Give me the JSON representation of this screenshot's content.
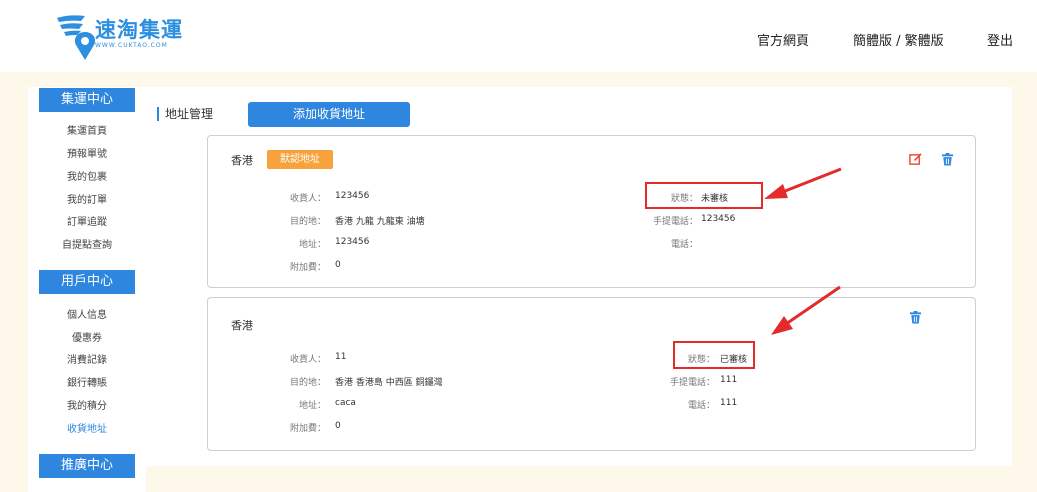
{
  "brand": {
    "name": "速淘集運",
    "site": "WWW.CUKTAO.COM"
  },
  "nav": {
    "official": "官方網頁",
    "lang": "簡體版 / 繁體版",
    "logout": "登出"
  },
  "sidebar": {
    "groups": [
      {
        "title": "集運中心",
        "items": [
          "集運首頁",
          "預報單號",
          "我的包裹",
          "我的訂單",
          "訂單追蹤",
          "自提點查詢"
        ]
      },
      {
        "title": "用戶中心",
        "items": [
          "個人信息",
          "優惠券",
          "消費記錄",
          "銀行轉賬",
          "我的積分",
          "收貨地址"
        ]
      },
      {
        "title": "推廣中心",
        "items": []
      }
    ],
    "active": "收貨地址"
  },
  "main": {
    "title": "地址管理",
    "add_label": "添加收貨地址",
    "labels": {
      "receiver": "收貨人：",
      "destination": "目的地：",
      "address": "地址：",
      "surcharge": "附加費：",
      "status": "狀態：",
      "mobile": "手提電話：",
      "phone": "電話："
    },
    "cards": [
      {
        "region": "香港",
        "default_tag": "默認地址",
        "receiver": "123456",
        "destination": "香港 九龍 九龍東 油塘",
        "address": "123456",
        "surcharge": "0",
        "status": "未審核",
        "mobile": "123456",
        "phone": ""
      },
      {
        "region": "香港",
        "receiver": "11",
        "destination": "香港 香港島 中西區 銅鑼灣",
        "address": "caca",
        "surcharge": "0",
        "status": "已審核",
        "mobile": "111",
        "phone": "111"
      }
    ]
  },
  "colors": {
    "accent": "#2f86df",
    "tag": "#f7a23b",
    "highlight": "#e32b2b",
    "edit_icon": "#e8442e",
    "page_bg": "#fdf8ea"
  },
  "icons": {
    "edit": "edit-icon",
    "delete": "trash-icon",
    "logo": "map-pin-wing-icon"
  }
}
